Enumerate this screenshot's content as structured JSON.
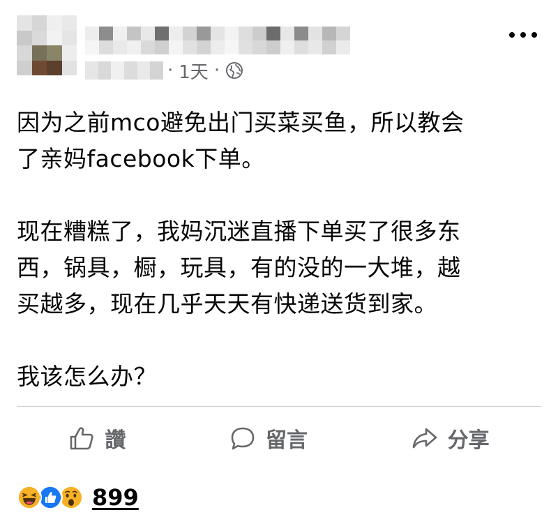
{
  "post": {
    "time": "1天",
    "separator": "·",
    "privacy_icon": "globe-icon",
    "more_icon": "more-horizontal-icon",
    "paragraphs": [
      [
        "因为之前mco避免出门买菜买鱼，所以教会",
        "了亲妈facebook下单。"
      ],
      [
        "现在糟糕了，我妈沉迷直播下单买了很多东",
        "西，锅具，橱，玩具，有的没的一大堆，越",
        "买越多，现在几乎天天有快递送货到家。"
      ],
      [
        "我该怎么办？"
      ]
    ]
  },
  "actions": {
    "like_label": "讚",
    "comment_label": "留言",
    "share_label": "分享"
  },
  "reactions": {
    "icons": [
      "haha-icon",
      "like-icon",
      "wow-icon"
    ],
    "count": "899"
  },
  "colors": {
    "text": "#050505",
    "secondary": "#65676b",
    "like_blue": "#1877f2",
    "reaction_yellow": "#f7b125",
    "divider": "#ced0d4"
  }
}
